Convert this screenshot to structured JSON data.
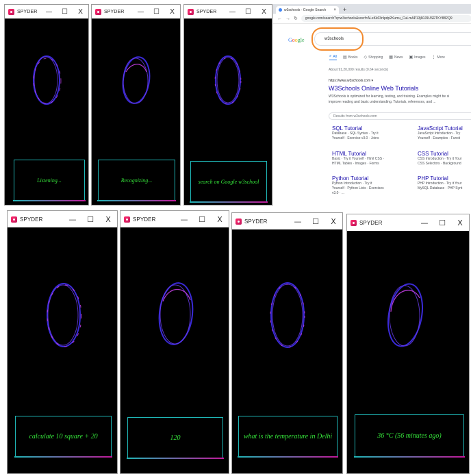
{
  "windows": [
    {
      "title": "SPYDER",
      "message": "Listening..."
    },
    {
      "title": "SPYDER",
      "message": "Recognizing..."
    },
    {
      "title": "SPYDER",
      "message": "search on Google w3school"
    },
    {
      "title": "SPYDER",
      "message": "calculate 10 square + 20"
    },
    {
      "title": "SPYDER",
      "message": "120"
    },
    {
      "title": "SPYDER",
      "message": "what is the temperature in Delhi"
    },
    {
      "title": "SPYDER",
      "message": "36 °C (56 minutes ago)"
    }
  ],
  "window_controls": {
    "minimize": "—",
    "maximize": "☐",
    "close": "X"
  },
  "browser": {
    "tab_title": "w3schools - Google Search",
    "tab_close": "×",
    "new_tab": "+",
    "nav": {
      "back": "←",
      "forward": "→",
      "reload": "↻"
    },
    "url": "google.com/search?q=w3schools&sxsrf=ALeKk03nlpdp2Kumu_CuLmAP13j60J9USRTKY882Q9",
    "logo": [
      "G",
      "o",
      "o",
      "gle"
    ],
    "search_query": "w3schools",
    "tabs": [
      {
        "icon": "⌕",
        "label": "All"
      },
      {
        "icon": "▤",
        "label": "Books"
      },
      {
        "icon": "◇",
        "label": "Shopping"
      },
      {
        "icon": "▦",
        "label": "News"
      },
      {
        "icon": "▣",
        "label": "Images"
      },
      {
        "icon": "⋮",
        "label": "More"
      }
    ],
    "result_count": "About 91,20,000 results (0.64 seconds)",
    "result": {
      "url": "https://www.w3schools.com  ▾",
      "title": "W3Schools Online Web Tutorials",
      "snippet_1": "W3Schools is optimized for learning, testing, and training. Examples might be si",
      "snippet_2": "improve reading and basic understanding. Tutorials, references, and ..."
    },
    "site_search_placeholder": "Results from w3schools.com",
    "sitelinks": [
      {
        "title": "SQL Tutorial",
        "d1": "Database · SQL Syntax · Try it",
        "d2": "Yourself · Exercise v3.0 · Joins"
      },
      {
        "title": "JavaScript Tutorial",
        "d1": "JavaScript Introduction · Try",
        "d2": "Yourself · Examples · Functi"
      },
      {
        "title": "HTML Tutorial",
        "d1": "Basic · Try it Yourself · Html CSS ·",
        "d2": "HTML Tables · Images · Forms"
      },
      {
        "title": "CSS Tutorial",
        "d1": "CSS Introduction · Try it Your",
        "d2": "CSS Selectors · Background"
      },
      {
        "title": "Python Tutorial",
        "d1": "Python Introduction · Try it",
        "d2": "Yourself · Python Lists · Exercises",
        "d3": "v3.0 · ..."
      },
      {
        "title": "PHP Tutorial",
        "d1": "PHP Introduction · Try it Your",
        "d2": "MySQL Database · PHP Synt"
      }
    ]
  }
}
